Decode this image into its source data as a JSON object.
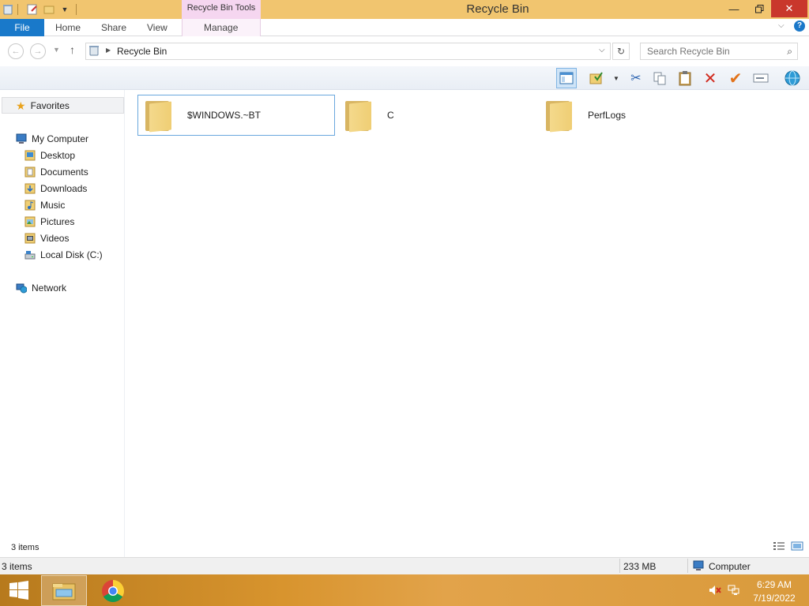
{
  "window": {
    "title": "Recycle Bin",
    "context_tab": "Recycle Bin Tools"
  },
  "ribbon": {
    "tabs": [
      "File",
      "Home",
      "Share",
      "View",
      "Manage"
    ]
  },
  "address": {
    "path": "Recycle Bin",
    "search_placeholder": "Search Recycle Bin"
  },
  "nav": {
    "favorites": "Favorites",
    "computer": "My Computer",
    "children": [
      "Desktop",
      "Documents",
      "Downloads",
      "Music",
      "Pictures",
      "Videos",
      "Local Disk (C:)"
    ],
    "network": "Network"
  },
  "files": [
    "$WINDOWS.~BT",
    "C",
    "PerfLogs"
  ],
  "status": {
    "items_inner": "3 items",
    "items_bar": "3 items",
    "size": "233 MB",
    "location": "Computer"
  },
  "taskbar": {
    "time": "6:29 AM",
    "date": "7/19/2022"
  },
  "colors": {
    "titlebar": "#f1c56f",
    "file_tab": "#1979ca",
    "context_tab": "#f5d6f0",
    "close_button": "#c9372c"
  }
}
